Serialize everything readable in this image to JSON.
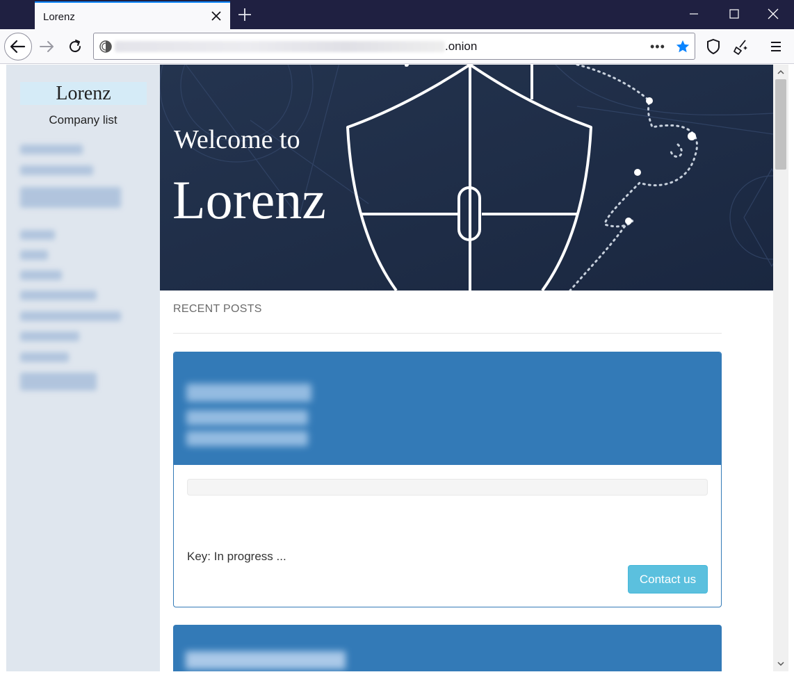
{
  "browser": {
    "tab_title": "Lorenz",
    "url_suffix": ".onion",
    "url_menu": "•••"
  },
  "sidebar": {
    "brand": "Lorenz",
    "company_list_label": "Company list"
  },
  "hero": {
    "welcome": "Welcome to",
    "title": "Lorenz"
  },
  "main": {
    "section_label": "RECENT POSTS",
    "post": {
      "key_status": "Key: In progress ...",
      "contact_label": "Contact us",
      "progress": 0
    }
  },
  "colors": {
    "titlebar": "#1f2041",
    "hero": "#1d2b45",
    "card_primary": "#337ab7",
    "button_info": "#5bc0de",
    "sidebar": "#dfe6ee",
    "accent_tab": "#0a84ff"
  }
}
